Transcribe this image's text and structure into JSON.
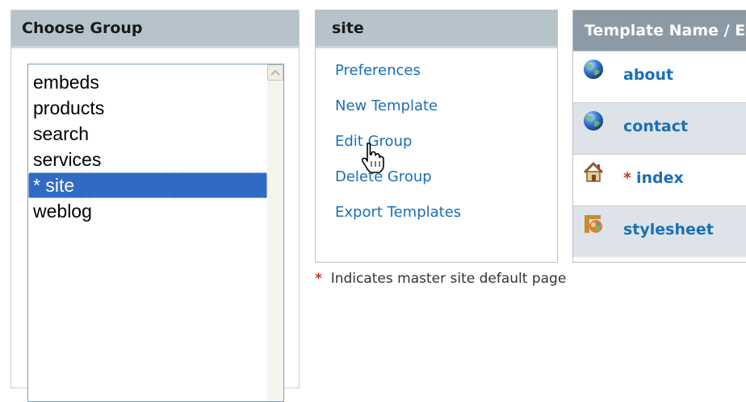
{
  "groups_panel": {
    "title": "Choose Group",
    "items": [
      "embeds",
      "products",
      "search",
      "services",
      "* site",
      "weblog"
    ],
    "selected": "* site"
  },
  "site_panel": {
    "title": "site",
    "links": [
      "Preferences",
      "New Template",
      "Edit Group",
      "Delete Group",
      "Export Templates"
    ]
  },
  "footnote": {
    "star": "*",
    "text": "Indicates master site default page"
  },
  "templates_panel": {
    "header": "Template Name / E",
    "rows": [
      {
        "name": "about",
        "icon": "globe-icon"
      },
      {
        "name": "contact",
        "icon": "globe-icon"
      },
      {
        "star": "*",
        "name": "index",
        "icon": "home-icon"
      },
      {
        "name": "stylesheet",
        "icon": "stylesheet-icon"
      }
    ]
  },
  "colors": {
    "header_bg": "#b6c3cb",
    "table_header_bg": "#8b9aa5",
    "link": "#1b6fb5",
    "selection": "#316ac5",
    "alt_row": "#dde3e8"
  }
}
